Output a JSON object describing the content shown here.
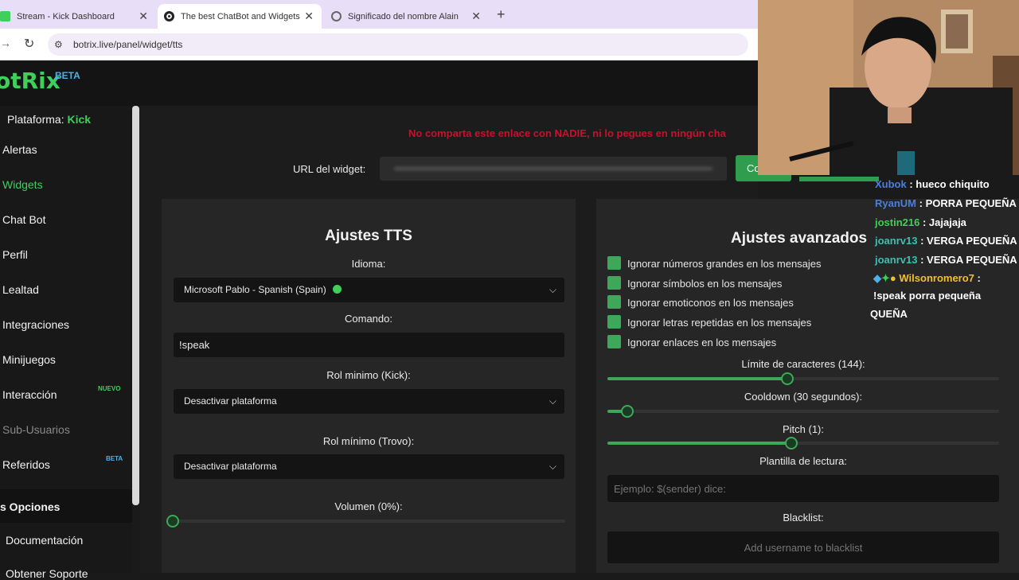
{
  "browser": {
    "tabs": [
      {
        "label": "Stream - Kick Dashboard"
      },
      {
        "label": "The best ChatBot and Widgets"
      },
      {
        "label": "Significado del nombre Alain"
      }
    ],
    "url": "botrix.live/panel/widget/tts"
  },
  "app": {
    "logo": "otRix",
    "logo_badge": "BETA",
    "platform_label": "Plataforma:",
    "platform_value": "Kick"
  },
  "sidebar": {
    "items": [
      {
        "label": "Alertas"
      },
      {
        "label": "Widgets"
      },
      {
        "label": "Chat Bot"
      },
      {
        "label": "Perfil"
      },
      {
        "label": "Lealtad"
      },
      {
        "label": "Integraciones"
      },
      {
        "label": "Minijuegos"
      },
      {
        "label": "Interacción",
        "badge": "NUEVO"
      },
      {
        "label": "Sub-Usuarios"
      },
      {
        "label": "Referidos",
        "badge": "BETA"
      }
    ],
    "section_title": "s Opciones",
    "docs_label": "Documentación",
    "last_partial": "Obtener Soporte"
  },
  "main": {
    "warning": "No comparta este enlace con NADIE, ni lo pegues en ningún cha",
    "url_label": "URL del widget:",
    "copy_label": "Co"
  },
  "tts": {
    "title": "Ajustes TTS",
    "idioma_label": "Idioma:",
    "idioma_value": "Microsoft Pablo - Spanish (Spain)",
    "comando_label": "Comando:",
    "comando_value": "!speak",
    "rol_kick_label": "Rol minimo (Kick):",
    "rol_kick_value": "Desactivar plataforma",
    "rol_trovo_label": "Rol mínimo (Trovo):",
    "rol_trovo_value": "Desactivar plataforma",
    "volumen_label": "Volumen (0%):",
    "volumen_value": 0
  },
  "advanced": {
    "title": "Ajustes avanzados",
    "checks": [
      {
        "label": "Ignorar números grandes en los mensajes"
      },
      {
        "label": "Ignorar símbolos en los mensajes"
      },
      {
        "label": "Ignorar emoticonos en los mensajes"
      },
      {
        "label": "Ignorar letras repetidas en los mensajes"
      },
      {
        "label": "Ignorar enlaces en los mensajes"
      }
    ],
    "char_limit_label": "Límite de caracteres (144):",
    "char_limit_fraction": 0.46,
    "cooldown_label": "Cooldown (30 segundos):",
    "cooldown_fraction": 0.05,
    "pitch_label": "Pitch (1):",
    "pitch_fraction": 0.47,
    "template_label": "Plantilla de lectura:",
    "template_placeholder": "Ejemplo: $(sender) dice:",
    "blacklist_label": "Blacklist:",
    "blacklist_placeholder": "Add username to blacklist"
  },
  "chat": [
    {
      "user": "Xubok",
      "sep": " : ",
      "msg": "hueco chiquito",
      "color": "#4a7fe0"
    },
    {
      "user": "RyanUM",
      "sep": " : ",
      "msg": "PORRA PEQUEÑA",
      "color": "#4a7fe0"
    },
    {
      "user": "jostin216",
      "sep": " : ",
      "msg": "Jajajaja",
      "color": "#3ed05a"
    },
    {
      "user": "joanrv13",
      "sep": " : ",
      "msg": "VERGA PEQUEÑA",
      "color": "#3ec0b0"
    },
    {
      "user": "joanrv13",
      "sep": " : ",
      "msg": "VERGA PEQUEÑA",
      "color": "#3ec0b0"
    },
    {
      "user": "Wilsonromero7",
      "sep": " :",
      "msg": "",
      "color": "#f0c030"
    }
  ],
  "chat_continuation": [
    "!speak porra pequeña",
    "QUEÑA"
  ],
  "colors": {
    "accent": "#3ed05a",
    "warning": "#c8102e",
    "bg": "#1c1c1c",
    "panel": "#262626"
  }
}
